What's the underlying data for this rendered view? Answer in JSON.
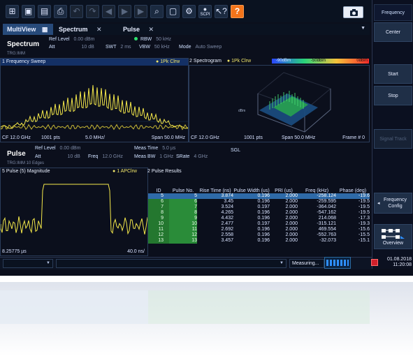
{
  "toolbar": {
    "icons": [
      "windows-icon",
      "folder-icon",
      "save-icon",
      "print-icon",
      "undo-icon",
      "redo-icon",
      "back-icon",
      "forward-icon",
      "forward2-icon",
      "zoom-icon",
      "fullscreen-icon",
      "settings-icon",
      "scpi-icon",
      "help-pointer-icon",
      "help-icon"
    ],
    "scpi_label": "SCPI",
    "help_label": "?"
  },
  "tabs": [
    {
      "label": "MultiView",
      "close": ""
    },
    {
      "label": "Spectrum",
      "close": "✕"
    },
    {
      "label": "Pulse",
      "close": "✕"
    }
  ],
  "softkeys": {
    "title": "Frequency",
    "center": "Center",
    "start": "Start",
    "stop": "Stop",
    "signal_track": "Signal Track",
    "freq_config": "Frequency Config",
    "overview": "Overview"
  },
  "spectrum": {
    "label": "Spectrum",
    "ref_level_label": "Ref Level",
    "ref_level": "0.00 dBm",
    "att_label": "Att",
    "att": "10 dB",
    "swt_label": "SWT",
    "swt": "2 ms",
    "rbw_label": "RBW",
    "rbw": "50 kHz",
    "vbw_label": "VBW",
    "vbw": "50 kHz",
    "mode_label": "Mode",
    "mode": "Auto Sweep",
    "trg": "TRG:IMM"
  },
  "freq_sweep": {
    "title": "1 Frequency Sweep",
    "trace": "1Pk Clrw",
    "cf": "CF 12.0 GHz",
    "pts": "1001 pts",
    "div": "5.0 MHz/",
    "span": "Span 50.0 MHz"
  },
  "spectrogram": {
    "title": "2 Spectrogram",
    "trace": "1Pk Clrw",
    "scale": [
      "-90dBm",
      "-50dBm",
      "0dBm"
    ],
    "cf": "CF 12.0 GHz",
    "pts": "1001 pts",
    "span": "Span 50.0 MHz",
    "frame": "Frame # 0"
  },
  "pulse": {
    "label": "Pulse",
    "ref_level_label": "Ref Level",
    "ref_level": "0.00 dBm",
    "att_label": "Att",
    "att": "10 dB",
    "freq_label": "Freq",
    "freq": "12.0 GHz",
    "meas_time_label": "Meas Time",
    "meas_time": "5.0 µs",
    "meas_bw_label": "Meas BW",
    "meas_bw": "1 GHz",
    "srate_label": "SRate",
    "srate": "4 GHz",
    "sgl": "SGL",
    "trg": "TRG:IMM 10 Edges"
  },
  "magnitude": {
    "title": "5 Pulse (5) Magnitude",
    "trace": "1 APClrw",
    "footer_left": "8.25775 µs",
    "footer_right": "40.0 ns/"
  },
  "results": {
    "title": "2 Pulse Results",
    "columns": [
      "ID",
      "Pulse No.",
      "Rise Time (ns)",
      "Pulse Width (us)",
      "PRI (us)",
      "Freq (kHz)",
      "Phase (deg)"
    ],
    "rows": [
      [
        "5",
        "5",
        "3.874",
        "0.196",
        "2.000",
        "-258.124",
        "-19.6"
      ],
      [
        "6",
        "6",
        "3.45",
        "0.196",
        "2.000",
        "-259.595",
        "-19.5"
      ],
      [
        "7",
        "7",
        "3.524",
        "0.197",
        "2.000",
        "-364.042",
        "-19.5"
      ],
      [
        "8",
        "8",
        "4.265",
        "0.196",
        "2.000",
        "-547.162",
        "-19.5"
      ],
      [
        "9",
        "9",
        "4.432",
        "0.196",
        "2.000",
        "214.068",
        "-17.3"
      ],
      [
        "10",
        "10",
        "2.477",
        "0.197",
        "2.000",
        "-315.121",
        "-19.3"
      ],
      [
        "11",
        "11",
        "2.692",
        "0.196",
        "2.000",
        "469.554",
        "-15.6"
      ],
      [
        "12",
        "12",
        "2.558",
        "0.196",
        "2.000",
        "-552.763",
        "-15.5"
      ],
      [
        "13",
        "13",
        "3.457",
        "0.196",
        "2.000",
        "-32.073",
        "-15.1"
      ]
    ]
  },
  "status": {
    "measuring": "Measuring...",
    "date": "01.08.2018",
    "time": "11:20:08"
  }
}
